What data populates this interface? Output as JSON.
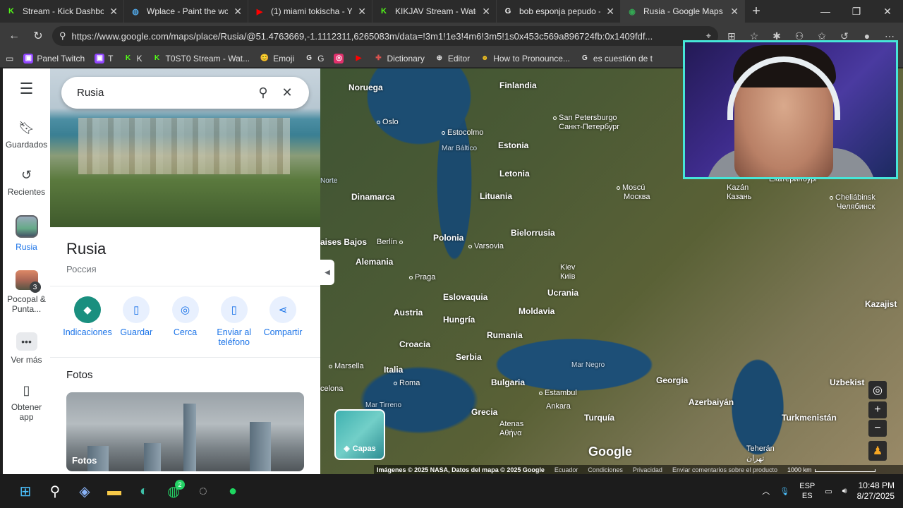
{
  "browser": {
    "tabs": [
      {
        "label": "Stream - Kick Dashboard",
        "icon": "K",
        "color": "#53fc18"
      },
      {
        "label": "Wplace - Paint the world",
        "icon": "◍",
        "color": "#4fa3e0"
      },
      {
        "label": "(1) miami tokischa - YouTube",
        "icon": "▶",
        "color": "#ff0000"
      },
      {
        "label": "KIKJAV Stream - Watch Live",
        "icon": "K",
        "color": "#53fc18"
      },
      {
        "label": "bob esponja pepudo - Buscar",
        "icon": "G",
        "color": "#ffffff"
      },
      {
        "label": "Rusia - Google Maps",
        "icon": "◉",
        "color": "#34a853"
      }
    ],
    "url": "https://www.google.com/maps/place/Rusia/@51.4763669,-1.1112311,6265083m/data=!3m1!1e3!4m6!3m5!1s0x453c569a896724fb:0x1409fdf...",
    "bookmarks": [
      {
        "label": "Panel Twitch",
        "icon": "▣",
        "color": "#9146ff"
      },
      {
        "label": "T",
        "icon": "▣",
        "color": "#9146ff"
      },
      {
        "label": "K",
        "icon": "K",
        "color": "#53fc18"
      },
      {
        "label": "T0ST0 Stream - Wat...",
        "icon": "K",
        "color": "#53fc18"
      },
      {
        "label": "Emoji",
        "icon": "😊",
        "color": "#f5c518"
      },
      {
        "label": "G",
        "icon": "G",
        "color": "#ffffff"
      },
      {
        "label": "",
        "icon": "◎",
        "color": "#e1306c"
      },
      {
        "label": "",
        "icon": "▶",
        "color": "#ff0000"
      },
      {
        "label": "Dictionary",
        "icon": "✚",
        "color": "#d9534f"
      },
      {
        "label": "Editor",
        "icon": "⊕",
        "color": "#cccccc"
      },
      {
        "label": "How to Pronounce...",
        "icon": "☻",
        "color": "#f0c020"
      },
      {
        "label": "es cuestión de t",
        "icon": "G",
        "color": "#ffffff"
      }
    ]
  },
  "rail": {
    "saved": "Guardados",
    "recent": "Recientes",
    "current": "Rusia",
    "pocopal": "Pocopal & Punta...",
    "pocopal_count": "3",
    "more": "Ver más",
    "get_app": "Obtener app"
  },
  "search": {
    "value": "Rusia"
  },
  "place": {
    "title": "Rusia",
    "subtitle": "Россия",
    "actions": [
      {
        "label": "Indicaciones",
        "icon": "◆"
      },
      {
        "label": "Guardar",
        "icon": "▯"
      },
      {
        "label": "Cerca",
        "icon": "◎"
      },
      {
        "label": "Enviar al teléfono",
        "icon": "▯"
      },
      {
        "label": "Compartir",
        "icon": "⋖"
      }
    ],
    "photos_title": "Fotos",
    "photo_label": "Fotos"
  },
  "map": {
    "labels": {
      "noruega": "Noruega",
      "finlandia": "Finlandia",
      "oslo": "Oslo",
      "estocolmo": "Estocolmo",
      "spb": "San Petersburgo",
      "spb_ru": "Санкт-Петербург",
      "mar_baltico": "Mar Báltico",
      "estonia": "Estonia",
      "letonia": "Letonia",
      "norte": "Norte",
      "dinamarca": "Dinamarca",
      "lituania": "Lituania",
      "moscu": "Moscú",
      "moscu_ru": "Москва",
      "kazan": "Kazán",
      "kazan_ru": "Казань",
      "ekaterin": "Екатеринбург",
      "cheliabinsk": "Cheliábinsk",
      "cheliabinsk_ru": "Челябинск",
      "bajos": "aises Bajos",
      "berlin": "Berlín",
      "polonia": "Polonia",
      "bielorrusia": "Bielorrusia",
      "varsovia": "Varsovia",
      "alemania": "Alemania",
      "kiev": "Kiev",
      "kiev_ru": "Київ",
      "praga": "Praga",
      "eslovaquia": "Eslovaquia",
      "ucrania": "Ucrania",
      "kazajist": "Kazajist",
      "austria": "Austria",
      "moldavia": "Moldavia",
      "hungria": "Hungría",
      "rumania": "Rumania",
      "croacia": "Croacia",
      "serbia": "Serbia",
      "marsella": "Marsella",
      "italia": "Italia",
      "mar_negro": "Mar Negro",
      "georgia": "Georgia",
      "uzbekist": "Uzbekist",
      "celona": "celona",
      "roma": "Roma",
      "bulgaria": "Bulgaria",
      "estambul": "Estambul",
      "ankara": "Ankara",
      "azerbaiyan": "Azerbaiyán",
      "turkmenistan": "Turkmenistán",
      "mar_tirreno": "Mar Tirreno",
      "grecia": "Grecia",
      "turquia": "Turquía",
      "atenas": "Atenas",
      "atenas_gr": "Αθήνα",
      "teheran": "Teherán",
      "teheran_fa": "تهران"
    },
    "layers_label": "Capas",
    "google": "Google",
    "attribution": [
      "Imágenes © 2025 NASA, Datos del mapa © 2025 Google",
      "Ecuador",
      "Condiciones",
      "Privacidad",
      "Enviar comentarios sobre el producto"
    ],
    "scale": "1000 km"
  },
  "taskbar": {
    "whatsapp_badge": "2",
    "lang_top": "ESP",
    "lang_bottom": "ES",
    "time": "10:48 PM",
    "date": "8/27/2025"
  }
}
